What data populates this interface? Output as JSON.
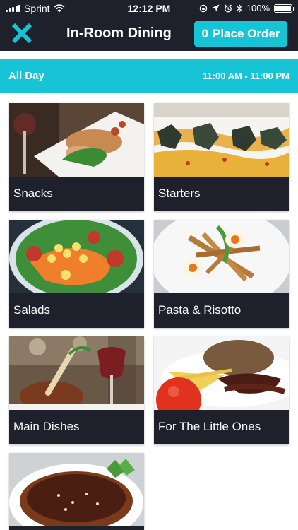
{
  "status_bar": {
    "carrier": "Sprint",
    "time": "12:12 PM",
    "battery": "100%",
    "battery_level": 1.0
  },
  "header": {
    "title": "In-Room Dining",
    "order_count": "0",
    "order_label": "Place Order"
  },
  "banner": {
    "period": "All Day",
    "hours": "11:00 AM - 11:00 PM"
  },
  "categories": [
    {
      "label": "Snacks"
    },
    {
      "label": "Starters"
    },
    {
      "label": "Salads"
    },
    {
      "label": "Pasta & Risotto"
    },
    {
      "label": "Main Dishes"
    },
    {
      "label": "For The Little Ones"
    },
    {
      "label": ""
    }
  ],
  "colors": {
    "accent": "#17c4d6",
    "dark": "#1e212b"
  }
}
